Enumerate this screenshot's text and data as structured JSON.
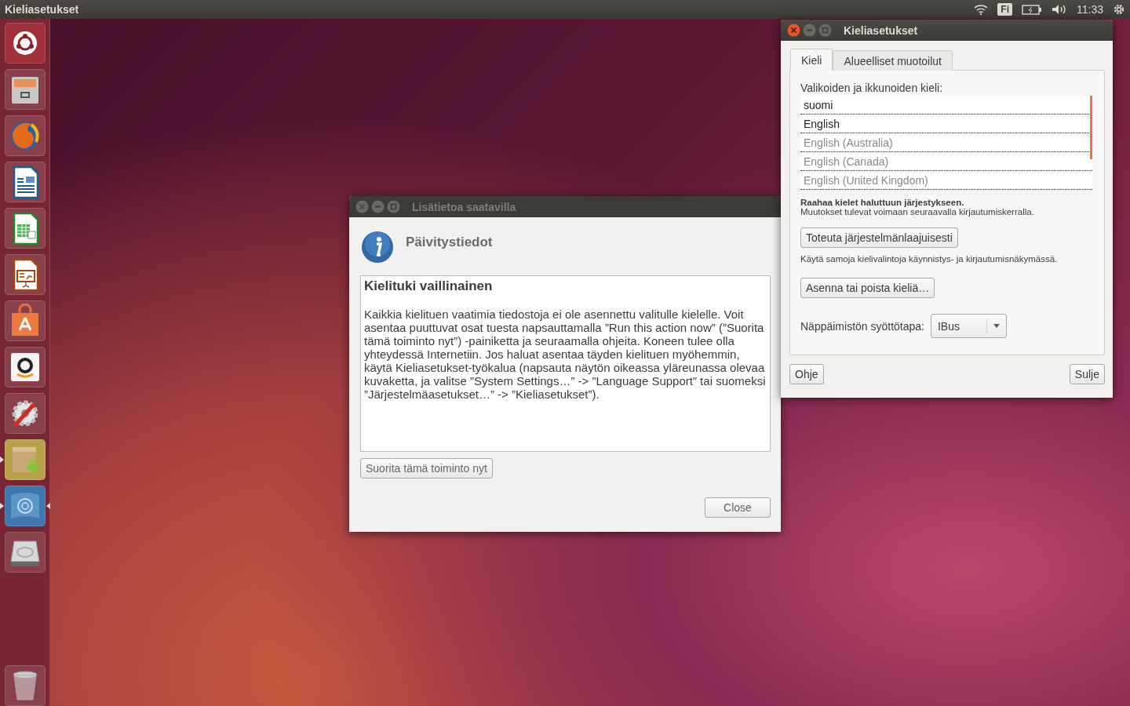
{
  "top_panel": {
    "title": "Kieliasetukset",
    "keyboard_layout": "Fi",
    "clock": "11:33"
  },
  "launcher": {
    "items": [
      {
        "kind": "dash",
        "running": false,
        "focused": false
      },
      {
        "kind": "files",
        "running": false,
        "focused": false
      },
      {
        "kind": "browser",
        "running": false,
        "focused": false
      },
      {
        "kind": "writer",
        "running": false,
        "focused": false
      },
      {
        "kind": "calc",
        "running": false,
        "focused": false
      },
      {
        "kind": "impress",
        "running": false,
        "focused": false
      },
      {
        "kind": "software",
        "running": false,
        "focused": false
      },
      {
        "kind": "amazon",
        "running": false,
        "focused": false
      },
      {
        "kind": "settings",
        "running": false,
        "focused": false
      },
      {
        "kind": "package",
        "running": true,
        "focused": false
      },
      {
        "kind": "language",
        "running": true,
        "focused": true
      },
      {
        "kind": "disk",
        "running": false,
        "focused": false
      },
      {
        "kind": "trash",
        "running": false,
        "focused": false
      }
    ]
  },
  "info_dialog": {
    "title": "Lisätietoa saatavilla",
    "focused": false,
    "heading": "Päivitystiedot",
    "message_title": "Kielituki vaillinainen",
    "message": "Kaikkia kielituen vaatimia tiedostoja ei ole asennettu valitulle kielelle. Voit asentaa puuttuvat osat tuesta napsauttamalla ”Run this action now” (”Suorita tämä toiminto nyt”) -painiketta ja seuraamalla ohjeita. Koneen tulee olla yhteydessä Internetiin. Jos haluat asentaa täyden kielituen myöhemmin, käytä Kieliasetukset-työkalua (napsauta näytön oikeassa yläreunassa olevaa kuvaketta, ja valitse ”System Settings…” -> ”Language Support” tai suomeksi ”Järjestelmäasetukset…” -> ”Kieliasetukset”).",
    "action_button": "Suorita tämä toiminto nyt",
    "close_button": "Close"
  },
  "language_window": {
    "title": "Kieliasetukset",
    "focused": true,
    "tabs": [
      {
        "label": "Kieli",
        "selected": true
      },
      {
        "label": "Alueelliset muotoilut",
        "selected": false
      }
    ],
    "list_label": "Valikoiden ja ikkunoiden kieli:",
    "languages": [
      {
        "name": "suomi",
        "active": true
      },
      {
        "name": "English",
        "active": true
      },
      {
        "name": "English (Australia)",
        "active": false
      },
      {
        "name": "English (Canada)",
        "active": false
      },
      {
        "name": "English (United Kingdom)",
        "active": false
      }
    ],
    "hint_bold": "Raahaa kielet haluttuun järjestykseen.",
    "hint": "Muutokset tulevat voimaan seuraavalla kirjautumiskerralla.",
    "apply_button": "Toteuta järjestelmänlaajuisesti",
    "apply_hint": "Käytä samoja kielivalintoja käynnistys- ja kirjautumisnäkymässä.",
    "install_button": "Asenna tai poista kieliä…",
    "input_method_label": "Näppäimistön syöttötapa:",
    "input_method_value": "IBus",
    "help_button": "Ohje",
    "close_button": "Sulje"
  }
}
